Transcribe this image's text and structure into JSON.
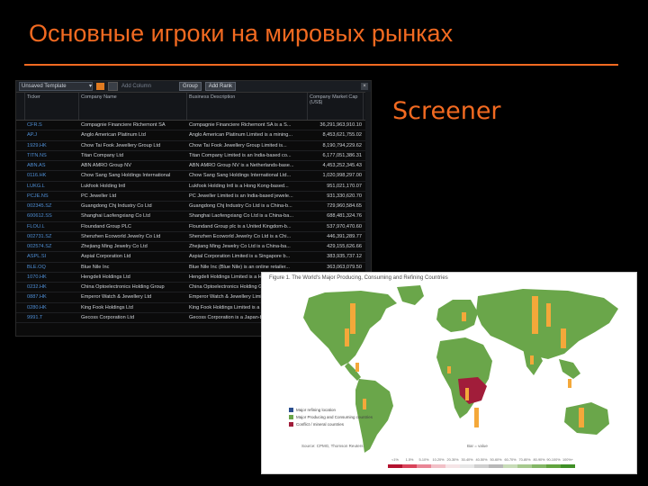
{
  "slide": {
    "title": "Основные игроки на мировых рынках",
    "screener_label": "Screener"
  },
  "toolbar": {
    "template": "Unsaved Template",
    "add_column": "Add Column",
    "group": "Group",
    "add_rank": "Add Rank",
    "close": "×"
  },
  "columns": [
    "Ticker",
    "Company Name",
    "Business Description",
    "Company Market Cap (US$)"
  ],
  "rows": [
    {
      "ticker": "CFR.S",
      "name": "Compagnie Financiere Richemont SA",
      "desc": "Compagnie Financiere Richemont SA is a S...",
      "mcap": "36,291,963,910.10"
    },
    {
      "ticker": "AP.J",
      "name": "Anglo American Platinum Ltd",
      "desc": "Anglo American Platinum Limited is a mining...",
      "mcap": "8,453,621,755.02"
    },
    {
      "ticker": "1929.HK",
      "name": "Chow Tai Fook Jewellery Group Ltd",
      "desc": "Chow Tai Fook Jewellery Group Limited is...",
      "mcap": "8,190,794,229.62"
    },
    {
      "ticker": "TITN.NS",
      "name": "Titan Company Ltd",
      "desc": "Titan Company Limited is an India-based co...",
      "mcap": "6,177,051,386.31"
    },
    {
      "ticker": "ABN.AS",
      "name": "ABN AMRO Group NV",
      "desc": "ABN AMRO Group NV is a Netherlands-base...",
      "mcap": "4,453,252,345.43"
    },
    {
      "ticker": "0116.HK",
      "name": "Chow Sang Sang Holdings International",
      "desc": "Chow Sang Sang Holdings International Ltd...",
      "mcap": "1,020,998,297.00"
    },
    {
      "ticker": "LUKG.L",
      "name": "Lukfook Holding Intl",
      "desc": "Lukfook Holding Intl is a Hong Kong-based...",
      "mcap": "951,021,170.07"
    },
    {
      "ticker": "PCJE.NS",
      "name": "PC Jeweller Ltd",
      "desc": "PC Jeweller Limited is an India-based jewele...",
      "mcap": "931,330,620.70"
    },
    {
      "ticker": "002345.SZ",
      "name": "Guangdong Chj Industry Co Ltd",
      "desc": "Guangdong Chj Industry Co Ltd is a China-b...",
      "mcap": "729,960,584.65"
    },
    {
      "ticker": "600612.SS",
      "name": "Shanghai Laofengxiang Co Ltd",
      "desc": "Shanghai Laofengxiang Co Ltd is a China-ba...",
      "mcap": "688,481,324.76"
    },
    {
      "ticker": "FLOU.L",
      "name": "Floundand Group PLC",
      "desc": "Floundand Group plc is a United Kingdom-b...",
      "mcap": "537,970,470.60"
    },
    {
      "ticker": "002731.SZ",
      "name": "Shenzhen Ecoworld Jewelry Co Ltd",
      "desc": "Shenzhen Ecoworld Jewelry Co Ltd is a Chi...",
      "mcap": "446,391,289.77"
    },
    {
      "ticker": "002574.SZ",
      "name": "Zhejiang Ming Jewelry Co Ltd",
      "desc": "Zhejiang Ming Jewelry Co Ltd is a China-ba...",
      "mcap": "429,155,626.66"
    },
    {
      "ticker": "ASPL.SI",
      "name": "Aspial Corporation Ltd",
      "desc": "Aspial Corporation Limited is a Singapore b...",
      "mcap": "383,935,737.12"
    },
    {
      "ticker": "BLE.OQ",
      "name": "Blue Nile Inc",
      "desc": "Blue Nile Inc (Blue Nile) is an online retailer...",
      "mcap": "363,063,079.50"
    },
    {
      "ticker": "1070.HK",
      "name": "Hengdeli Holdings Ltd",
      "desc": "Hengdeli Holdings Limited is a Hong Kon...",
      "mcap": ""
    },
    {
      "ticker": "0232.HK",
      "name": "China Optoelectronics Holding Group",
      "desc": "China Optoelectronics Holding Group is...",
      "mcap": ""
    },
    {
      "ticker": "0887.HK",
      "name": "Emperor Watch & Jewellery Ltd",
      "desc": "Emperor Watch & Jewellery Limited is a...",
      "mcap": ""
    },
    {
      "ticker": "0280.HK",
      "name": "King Fook Holdings Ltd",
      "desc": "King Fook Holdings Limited is a Hong Kon...",
      "mcap": ""
    },
    {
      "ticker": "9991.T",
      "name": "Gecoss Corporation Ltd",
      "desc": "Gecoss Corporation is a Japan-based co...",
      "mcap": ""
    }
  ],
  "figure": {
    "caption": "Figure 1. The World's Major Producing, Consuming and Refining Countries",
    "legend": [
      {
        "label": "Major refining location",
        "color": "#2b4f8f"
      },
      {
        "label": "Major Producing and Consuming countries",
        "color": "#6aa64a"
      },
      {
        "label": "Conflict / mineral countries",
        "color": "#a11d3a"
      }
    ],
    "source": "Source: CPMG, Thomson Reuters",
    "note": "Bar = value",
    "scale_labels": [
      "<1%",
      "1-5%",
      "5-10%",
      "10-20%",
      "20-30%",
      "30-40%",
      "40-50%",
      "50-60%",
      "60-70%",
      "70-80%",
      "80-90%",
      "90-100%",
      "100%+"
    ],
    "scale_colors": [
      "#b3122e",
      "#d9435a",
      "#e98595",
      "#f2c0c7",
      "#f5e4e6",
      "#e6e6e6",
      "#cfcfcf",
      "#b8b8b8",
      "#c8dcb8",
      "#a6c98e",
      "#84b766",
      "#62a43e",
      "#3f8f26"
    ],
    "colors": {
      "land": "#6aa64a",
      "ocean": "#ffffff",
      "bars": "#f4a83a",
      "conflict": "#a11d3a",
      "refine": "#2b4f8f"
    }
  }
}
